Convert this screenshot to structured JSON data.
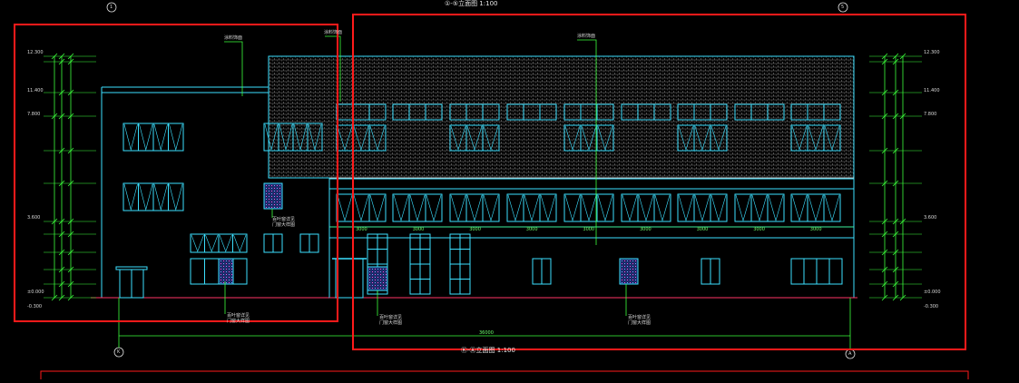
{
  "drawing": {
    "top_title": "①-⑤立面图 1:100",
    "bottom_title": "Ⓚ-Ⓐ立面图 1:100",
    "axis_top_left": "1",
    "axis_top_right": "5",
    "axis_bottom_left": "K",
    "axis_bottom_right": "A",
    "overall_dim": "36000",
    "callouts": {
      "roof_finish": "涂料饰面",
      "wall_finish": "涂料饰面",
      "top_left_note": "涂料饰面",
      "grille_a": "百叶窗详见",
      "grille_a2": "门窗大样图",
      "grille_b": "百叶窗详见",
      "grille_b2": "门窗大样图",
      "grille_c": "百叶窗详见",
      "grille_c2": "门窗大样图",
      "grille_d": "百叶窗详见",
      "grille_d2": "门窗大样图"
    },
    "levels_left": [
      "12.300",
      "11.400",
      "7.800",
      "3.600",
      "±0.000",
      "-0.300"
    ],
    "levels_right": [
      "12.300",
      "11.400",
      "7.800",
      "3.600",
      "±0.000",
      "-0.300"
    ],
    "bay_dims": [
      "3000",
      "3000",
      "3000",
      "3000",
      "3000",
      "3000",
      "3000",
      "3000",
      "3000"
    ]
  },
  "colors": {
    "background": "#000000",
    "line_cyan": "#00d8ff",
    "line_green": "#3cff3c",
    "highlight_red": "#ff1a1a",
    "hatch_gray": "#8a8a8a"
  }
}
